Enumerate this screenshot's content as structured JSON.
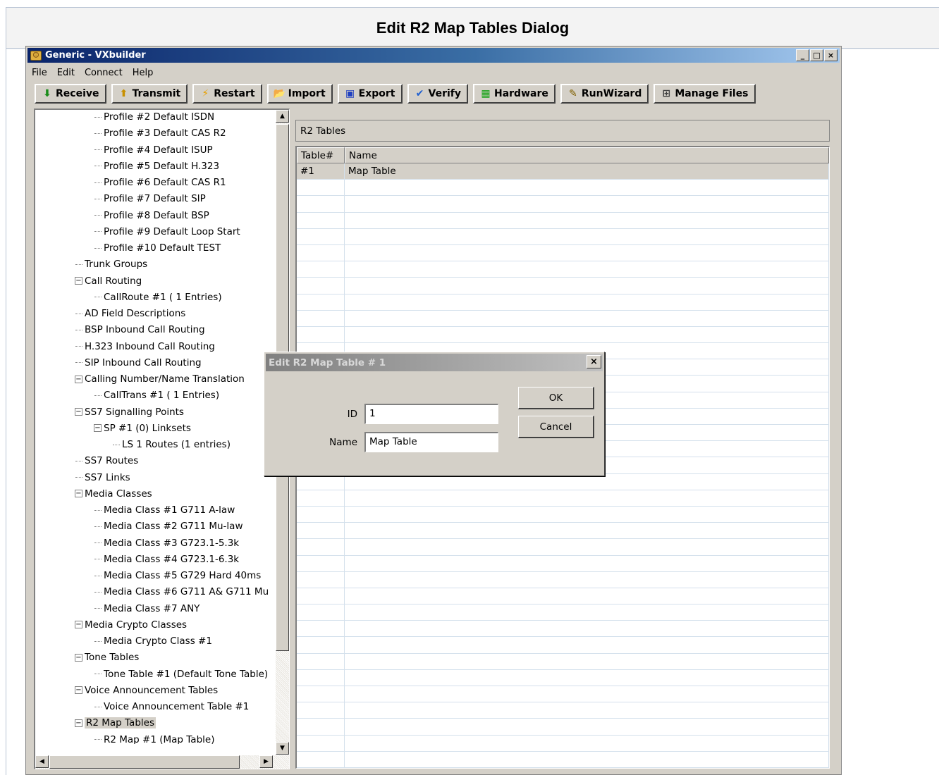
{
  "page": {
    "heading": "Edit R2 Map Tables Dialog"
  },
  "window": {
    "title": "Generic - VXbuilder",
    "controls": {
      "minimize": "_",
      "maximize": "□",
      "close": "×"
    }
  },
  "menu": [
    "File",
    "Edit",
    "Connect",
    "Help"
  ],
  "toolbar": [
    {
      "label": "Receive",
      "icon": "down-arrow-icon",
      "glyph": "⬇",
      "color": "#1a8c1a"
    },
    {
      "label": "Transmit",
      "icon": "up-arrow-icon",
      "glyph": "⬆",
      "color": "#c89000"
    },
    {
      "label": "Restart",
      "icon": "lightning-icon",
      "glyph": "⚡",
      "color": "#e8a000"
    },
    {
      "label": "Import",
      "icon": "folder-icon",
      "glyph": "📂",
      "color": "#c89000"
    },
    {
      "label": "Export",
      "icon": "floppy-disk-icon",
      "glyph": "▣",
      "color": "#2040c0"
    },
    {
      "label": "Verify",
      "icon": "check-icon",
      "glyph": "✔",
      "color": "#2060d0"
    },
    {
      "label": "Hardware",
      "icon": "hardware-grid-icon",
      "glyph": "▦",
      "color": "#10a010"
    },
    {
      "label": "RunWizard",
      "icon": "wizard-icon",
      "glyph": "✎",
      "color": "#806000"
    },
    {
      "label": "Manage Files",
      "icon": "files-tree-icon",
      "glyph": "⊞",
      "color": "#404040"
    }
  ],
  "tree": [
    {
      "label": "Profile #2 Default ISDN",
      "level": 3,
      "expander": ""
    },
    {
      "label": "Profile #3 Default CAS R2",
      "level": 3,
      "expander": ""
    },
    {
      "label": "Profile #4 Default ISUP",
      "level": 3,
      "expander": ""
    },
    {
      "label": "Profile #5 Default H.323",
      "level": 3,
      "expander": ""
    },
    {
      "label": "Profile #6 Default CAS R1",
      "level": 3,
      "expander": ""
    },
    {
      "label": "Profile #7 Default SIP",
      "level": 3,
      "expander": ""
    },
    {
      "label": "Profile #8 Default BSP",
      "level": 3,
      "expander": ""
    },
    {
      "label": "Profile #9 Default Loop Start",
      "level": 3,
      "expander": ""
    },
    {
      "label": "Profile #10 Default TEST",
      "level": 3,
      "expander": ""
    },
    {
      "label": "Trunk Groups",
      "level": 2,
      "expander": ""
    },
    {
      "label": "Call Routing",
      "level": 2,
      "expander": "−"
    },
    {
      "label": "CallRoute #1 ( 1 Entries)",
      "level": 3,
      "expander": ""
    },
    {
      "label": "AD Field Descriptions",
      "level": 2,
      "expander": ""
    },
    {
      "label": "BSP Inbound Call Routing",
      "level": 2,
      "expander": ""
    },
    {
      "label": "H.323 Inbound Call Routing",
      "level": 2,
      "expander": ""
    },
    {
      "label": "SIP Inbound Call Routing",
      "level": 2,
      "expander": ""
    },
    {
      "label": "Calling Number/Name Translation",
      "level": 2,
      "expander": "−"
    },
    {
      "label": "CallTrans #1 ( 1 Entries)",
      "level": 3,
      "expander": ""
    },
    {
      "label": "SS7 Signalling Points",
      "level": 2,
      "expander": "−"
    },
    {
      "label": "SP #1 (0) Linksets",
      "level": 3,
      "expander": "−"
    },
    {
      "label": "LS 1 Routes (1 entries)",
      "level": 4,
      "expander": ""
    },
    {
      "label": "SS7 Routes",
      "level": 2,
      "expander": ""
    },
    {
      "label": "SS7 Links",
      "level": 2,
      "expander": ""
    },
    {
      "label": "Media Classes",
      "level": 2,
      "expander": "−"
    },
    {
      "label": "Media Class #1 G711 A-law",
      "level": 3,
      "expander": ""
    },
    {
      "label": "Media Class #2 G711 Mu-law",
      "level": 3,
      "expander": ""
    },
    {
      "label": "Media Class #3 G723.1-5.3k",
      "level": 3,
      "expander": ""
    },
    {
      "label": "Media Class #4 G723.1-6.3k",
      "level": 3,
      "expander": ""
    },
    {
      "label": "Media Class #5 G729 Hard 40ms",
      "level": 3,
      "expander": ""
    },
    {
      "label": "Media Class #6 G711 A& G711 Mu",
      "level": 3,
      "expander": ""
    },
    {
      "label": "Media Class #7 ANY",
      "level": 3,
      "expander": ""
    },
    {
      "label": "Media Crypto Classes",
      "level": 2,
      "expander": "−"
    },
    {
      "label": "Media Crypto Class #1",
      "level": 3,
      "expander": ""
    },
    {
      "label": "Tone Tables",
      "level": 2,
      "expander": "−"
    },
    {
      "label": "Tone Table #1 (Default Tone Table)",
      "level": 3,
      "expander": ""
    },
    {
      "label": "Voice Announcement Tables",
      "level": 2,
      "expander": "−"
    },
    {
      "label": "Voice Announcement Table #1",
      "level": 3,
      "expander": ""
    },
    {
      "label": "R2 Map Tables",
      "level": 2,
      "expander": "−",
      "selected": true
    },
    {
      "label": "R2 Map #1 (Map Table)",
      "level": 3,
      "expander": ""
    }
  ],
  "panel": {
    "title": "R2 Tables",
    "columns": [
      "Table#",
      "Name"
    ],
    "rows": [
      {
        "table": "#1",
        "name": "Map Table",
        "selected": true
      }
    ],
    "empty_rows": 36
  },
  "dialog": {
    "title": "Edit R2 Map Table # 1",
    "close": "×",
    "id_label": "ID",
    "id_value": "1",
    "name_label": "Name",
    "name_value": "Map Table",
    "ok_label": "OK",
    "cancel_label": "Cancel"
  }
}
